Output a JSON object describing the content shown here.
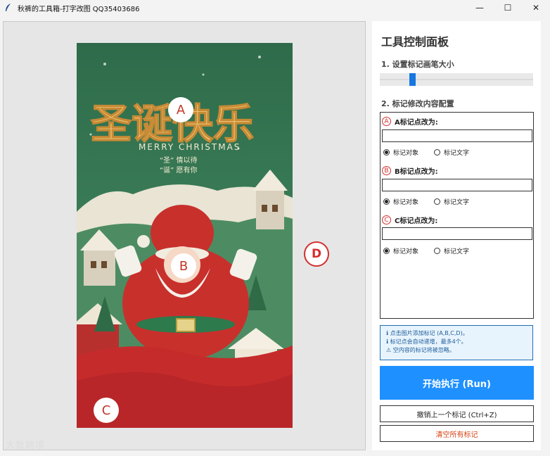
{
  "window": {
    "title": "秋裤的工具箱-打字改图 QQ35403686",
    "minimize": "—",
    "maximize": "☐",
    "close": "✕"
  },
  "canvas": {
    "markers": {
      "a": "A",
      "b": "B",
      "c": "C",
      "d": "D"
    },
    "poster": {
      "title": "圣诞快乐",
      "subtitle": "MERRY CHRISTMAS",
      "line1": "“圣” 情以待",
      "line2": "“诞” 愿有你"
    },
    "watermark": "大数跨境"
  },
  "panel": {
    "title": "工具控制面板",
    "section1": "1. 设置标记画笔大小",
    "slider_value": 0.2,
    "section2": "2. 标记修改内容配置",
    "groups": [
      {
        "badge": "A",
        "label": "A标记点改为:",
        "value": "",
        "opt1": "标记对象",
        "opt2": "标记文字"
      },
      {
        "badge": "B",
        "label": "B标记点改为:",
        "value": "",
        "opt1": "标记对象",
        "opt2": "标记文字"
      },
      {
        "badge": "C",
        "label": "C标记点改为:",
        "value": "",
        "opt1": "标记对象",
        "opt2": "标记文字"
      }
    ],
    "info": [
      "ℹ 点击图片添加标记 (A,B,C,D)。",
      "ℹ 标记点会自动递增，最多4个。",
      "⚠ 空内容的标记将被忽略。"
    ],
    "run_button": "开始执行 (Run)",
    "undo_button": "撤销上一个标记 (Ctrl+Z)",
    "clear_button": "清空所有标记",
    "colors": {
      "accent": "#1e90ff",
      "marker": "#d32f2f",
      "clear_text": "#d84315",
      "info_bg": "#e8f4fd"
    }
  }
}
